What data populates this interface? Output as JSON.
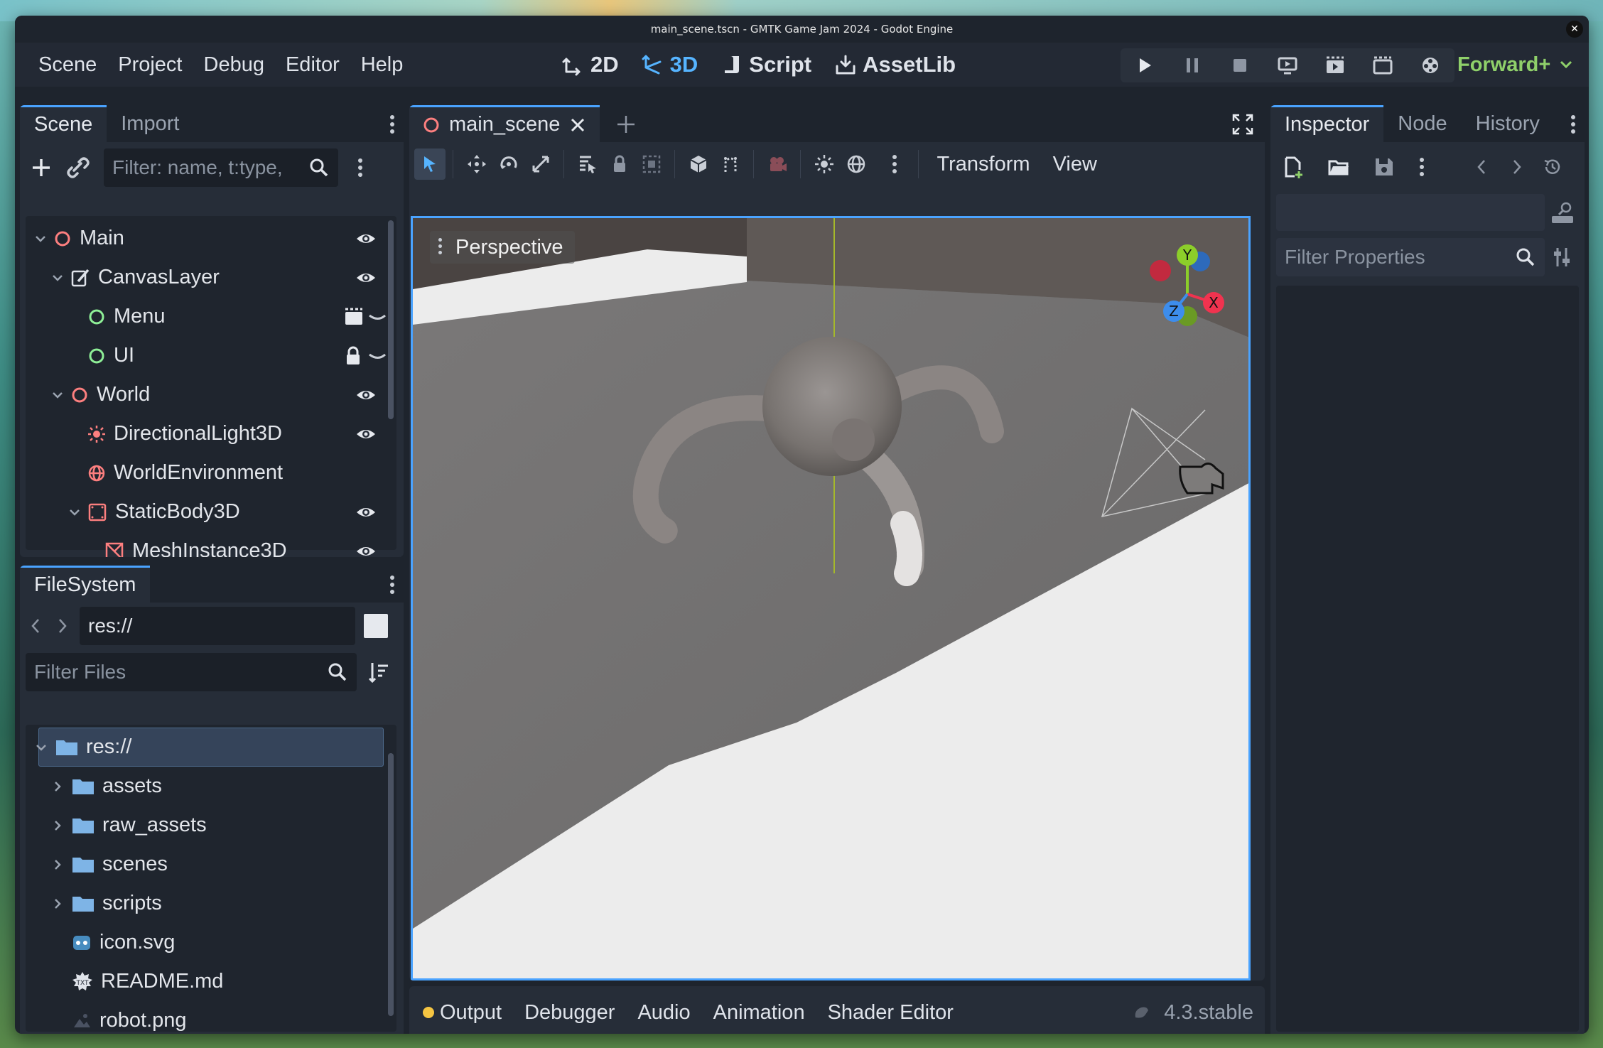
{
  "window": {
    "title": "main_scene.tscn - GMTK Game Jam 2024 - Godot Engine",
    "close_glyph": "✕"
  },
  "menubar": {
    "items": [
      "Scene",
      "Project",
      "Debug",
      "Editor",
      "Help"
    ]
  },
  "workspaces": {
    "items": [
      {
        "label": "2D",
        "icon": "2d-icon",
        "active": false
      },
      {
        "label": "3D",
        "icon": "3d-icon",
        "active": true
      },
      {
        "label": "Script",
        "icon": "script-icon",
        "active": false
      },
      {
        "label": "AssetLib",
        "icon": "assetlib-icon",
        "active": false
      }
    ]
  },
  "run_controls": [
    "play-icon",
    "pause-icon",
    "stop-icon",
    "remote-debug-icon",
    "play-scene-icon",
    "play-custom-scene-icon",
    "movie-maker-icon"
  ],
  "renderer": {
    "label": "Forward+"
  },
  "scene_dock": {
    "tabs": [
      "Scene",
      "Import"
    ],
    "filter_placeholder": "Filter: name, t:type,",
    "nodes": [
      {
        "label": "Main",
        "depth": 0,
        "icon": "node3d-icon",
        "color": "#fc7f7f",
        "expanded": true,
        "right_icon": "eye-icon"
      },
      {
        "label": "CanvasLayer",
        "depth": 1,
        "icon": "canvaslayer-icon",
        "color": "#dfe3ea",
        "expanded": true,
        "right_icon": "eye-icon"
      },
      {
        "label": "Menu",
        "depth": 2,
        "icon": "control-icon",
        "color": "#8eef97",
        "expanded": null,
        "right_icon": "instance-icon"
      },
      {
        "label": "UI",
        "depth": 2,
        "icon": "control-icon",
        "color": "#8eef97",
        "expanded": null,
        "right_icon": "lock-icon"
      },
      {
        "label": "World",
        "depth": 1,
        "icon": "node3d-icon",
        "color": "#fc7f7f",
        "expanded": true,
        "right_icon": "eye-icon"
      },
      {
        "label": "DirectionalLight3D",
        "depth": 2,
        "icon": "light-icon",
        "color": "#fc7f7f",
        "expanded": null,
        "right_icon": "eye-icon"
      },
      {
        "label": "WorldEnvironment",
        "depth": 2,
        "icon": "environment-icon",
        "color": "#fc7f7f",
        "expanded": null,
        "right_icon": ""
      },
      {
        "label": "StaticBody3D",
        "depth": 2,
        "icon": "staticbody-icon",
        "color": "#fc7f7f",
        "expanded": true,
        "right_icon": "eye-icon"
      },
      {
        "label": "MeshInstance3D",
        "depth": 3,
        "icon": "mesh-icon",
        "color": "#fc7f7f",
        "expanded": null,
        "right_icon": "eye-icon"
      }
    ]
  },
  "filesystem_dock": {
    "tabs": [
      "FileSystem"
    ],
    "path": "res://",
    "filter_placeholder": "Filter Files",
    "items": [
      {
        "label": "res://",
        "depth": 0,
        "icon": "folder-icon",
        "selected": true,
        "expandable": true
      },
      {
        "label": "assets",
        "depth": 1,
        "icon": "folder-icon",
        "selected": false,
        "expandable": true
      },
      {
        "label": "raw_assets",
        "depth": 1,
        "icon": "folder-icon",
        "selected": false,
        "expandable": true
      },
      {
        "label": "scenes",
        "depth": 1,
        "icon": "folder-icon",
        "selected": false,
        "expandable": true
      },
      {
        "label": "scripts",
        "depth": 1,
        "icon": "folder-icon",
        "selected": false,
        "expandable": true
      },
      {
        "label": "icon.svg",
        "depth": 1,
        "icon": "godot-svg-icon",
        "selected": false,
        "expandable": false
      },
      {
        "label": "README.md",
        "depth": 1,
        "icon": "text-file-icon",
        "selected": false,
        "expandable": false
      },
      {
        "label": "robot.png",
        "depth": 1,
        "icon": "image-file-icon",
        "selected": false,
        "expandable": false
      }
    ]
  },
  "editor": {
    "scene_tab": "main_scene",
    "toolbar_text": [
      "Transform",
      "View"
    ],
    "viewport_label": "Perspective",
    "gizmo_axes": [
      "Y",
      "X",
      "Z"
    ]
  },
  "inspector_dock": {
    "tabs": [
      "Inspector",
      "Node",
      "History"
    ],
    "filter_placeholder": "Filter Properties"
  },
  "bottom_panel": {
    "tabs": [
      "Output",
      "Debugger",
      "Audio",
      "Animation",
      "Shader Editor"
    ],
    "version": "4.3.stable"
  },
  "colors": {
    "accent": "#4aa3ff",
    "node3d": "#fc7f7f",
    "control": "#8eef97",
    "renderer": "#8fd06a",
    "output_dot": "#f5c542"
  }
}
